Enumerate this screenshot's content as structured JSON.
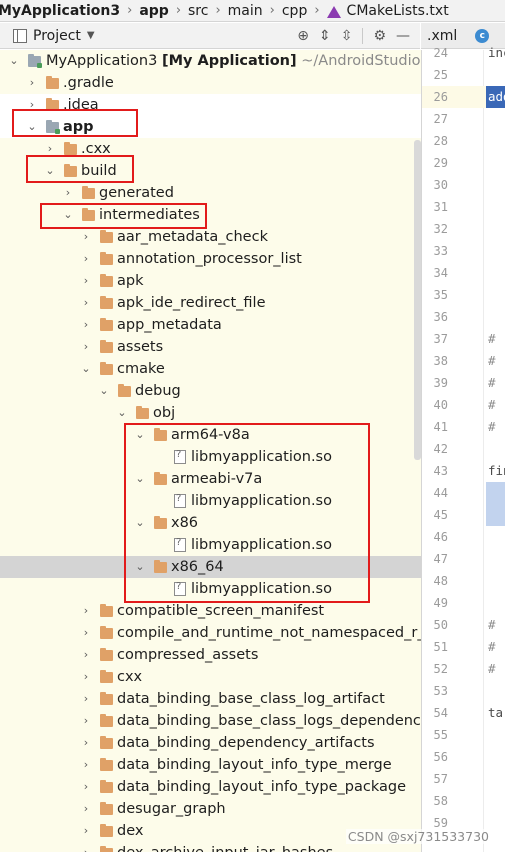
{
  "breadcrumb": {
    "items": [
      "MyApplication3",
      "app",
      "src",
      "main",
      "cpp",
      "CMakeLists.txt"
    ]
  },
  "project_panel": {
    "title": "Project",
    "toolbar_icons": [
      "crosshair-icon",
      "expand-all-icon",
      "collapse-all-icon",
      "gear-icon",
      "minimize-icon"
    ]
  },
  "editor_tabs": [
    ".xml",
    "c-file"
  ],
  "tree": {
    "root_label": "MyApplication3",
    "root_module": "[My Application]",
    "root_path": "~/AndroidStudioPro",
    "items": [
      ".gradle",
      ".idea",
      "app",
      ".cxx",
      "build",
      "generated",
      "intermediates",
      "aar_metadata_check",
      "annotation_processor_list",
      "apk",
      "apk_ide_redirect_file",
      "app_metadata",
      "assets",
      "cmake",
      "debug",
      "obj",
      "arm64-v8a",
      "libmyapplication.so",
      "armeabi-v7a",
      "libmyapplication.so",
      "x86",
      "libmyapplication.so",
      "x86_64",
      "libmyapplication.so",
      "compatible_screen_manifest",
      "compile_and_runtime_not_namespaced_r_cl",
      "compressed_assets",
      "cxx",
      "data_binding_base_class_log_artifact",
      "data_binding_base_class_logs_dependency_",
      "data_binding_dependency_artifacts",
      "data_binding_layout_info_type_merge",
      "data_binding_layout_info_type_package",
      "desugar_graph",
      "dex",
      "dex_archive_input_jar_hashes"
    ]
  },
  "gutter": {
    "line_numbers": [
      "24",
      "25",
      "26",
      "27",
      "28",
      "29",
      "30",
      "31",
      "32",
      "33",
      "34",
      "35",
      "36",
      "37",
      "38",
      "39",
      "40",
      "41",
      "42",
      "43",
      "44",
      "45",
      "46",
      "47",
      "48",
      "49",
      "50",
      "51",
      "52",
      "53",
      "54",
      "55",
      "56",
      "57",
      "58",
      "59"
    ],
    "code_fragments": {
      "24": "inc",
      "26": "add",
      "37": "# ",
      "38": "# ",
      "39": "# ",
      "40": "# ",
      "41": "# ",
      "43": "fin",
      "50": "# ",
      "51": "# ",
      "52": "# ",
      "54": "tar"
    }
  },
  "watermark": "CSDN @sxj731533730",
  "colors": {
    "tree_background": "#fdfcea",
    "folder": "#e0a167",
    "annotation_red": "#e21b1b",
    "selection": "#d4d4d4"
  }
}
